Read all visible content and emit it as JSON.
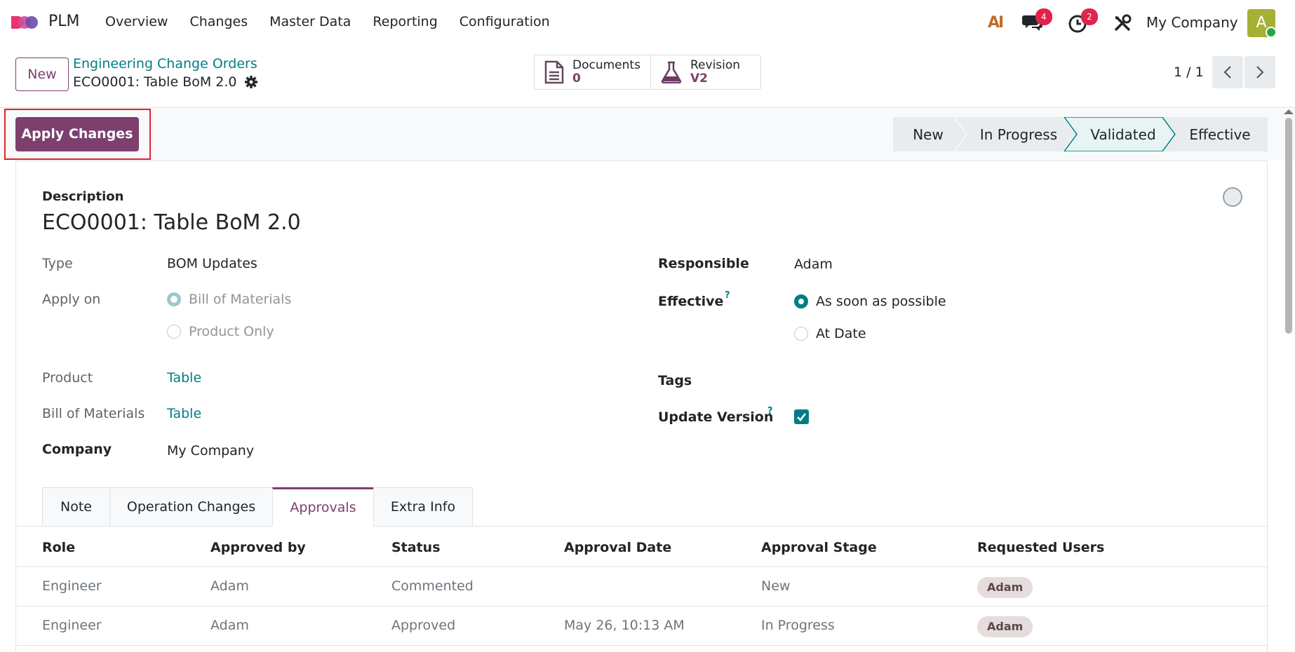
{
  "app": {
    "name": "PLM",
    "menu": [
      "Overview",
      "Changes",
      "Master Data",
      "Reporting",
      "Configuration"
    ],
    "ai_label": "AI",
    "messages_count": "4",
    "activities_count": "2",
    "company": "My Company",
    "avatar_initial": "A"
  },
  "control_panel": {
    "new_label": "New",
    "breadcrumb": "Engineering Change Orders",
    "record_title": "ECO0001: Table BoM 2.0",
    "smart_buttons": [
      {
        "label": "Documents",
        "value": "0",
        "icon": "document-icon"
      },
      {
        "label": "Revision",
        "value": "V2",
        "icon": "flask-icon"
      }
    ],
    "pager": "1 / 1"
  },
  "statusbar": {
    "apply_label": "Apply Changes",
    "stages": [
      "New",
      "In Progress",
      "Validated",
      "Effective"
    ],
    "current_stage": "Validated"
  },
  "form": {
    "description_label": "Description",
    "title": "ECO0001: Table BoM 2.0",
    "type_label": "Type",
    "type_value": "BOM Updates",
    "apply_on_label": "Apply on",
    "apply_on_options": [
      "Bill of Materials",
      "Product Only"
    ],
    "apply_on_selected": "Bill of Materials",
    "product_label": "Product",
    "product_value": "Table",
    "bom_label": "Bill of Materials",
    "bom_value": "Table",
    "company_label": "Company",
    "company_value": "My Company",
    "responsible_label": "Responsible",
    "responsible_value": "Adam",
    "effective_label": "Effective",
    "effective_options": [
      "As soon as possible",
      "At Date"
    ],
    "effective_selected": "As soon as possible",
    "tags_label": "Tags",
    "update_version_label": "Update Version",
    "update_version_checked": true,
    "help_mark": "?"
  },
  "tabs": {
    "items": [
      "Note",
      "Operation Changes",
      "Approvals",
      "Extra Info"
    ],
    "active": "Approvals"
  },
  "approvals": {
    "columns": [
      "Role",
      "Approved by",
      "Status",
      "Approval Date",
      "Approval Stage",
      "Requested Users"
    ],
    "rows": [
      {
        "role": "Engineer",
        "approved_by": "Adam",
        "status": "Commented",
        "date": "",
        "stage": "New",
        "users": "Adam"
      },
      {
        "role": "Engineer",
        "approved_by": "Adam",
        "status": "Approved",
        "date": "May 26, 10:13 AM",
        "stage": "In Progress",
        "users": "Adam"
      }
    ]
  },
  "colors": {
    "primary": "#7c3f6e",
    "link": "#017e84",
    "badge": "#e0234b",
    "highlight": "#e0232d"
  }
}
